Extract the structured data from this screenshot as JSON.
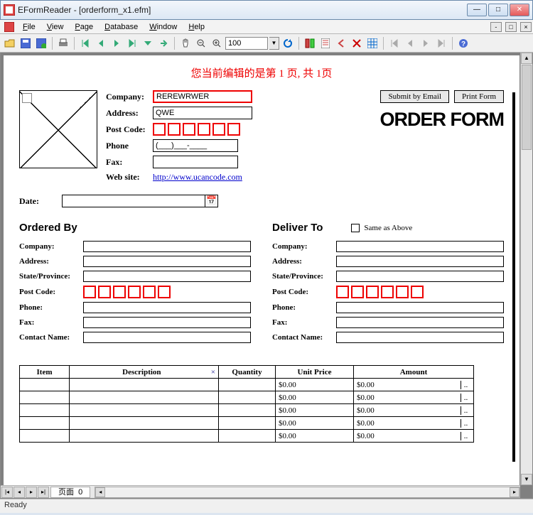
{
  "window": {
    "title": "EFormReader - [orderform_x1.efm]"
  },
  "menu": {
    "file": "File",
    "view": "View",
    "page": "Page",
    "database": "Database",
    "window": "Window",
    "help": "Help"
  },
  "toolbar": {
    "zoom_value": "100"
  },
  "banner": "您当前编辑的是第 1 页, 共 1页",
  "header": {
    "company_label": "Company:",
    "company_value": "REREWRWER",
    "address_label": "Address:",
    "address_value": "QWE",
    "postcode_label": "Post Code:",
    "phone_label": "Phone",
    "phone_value": "(___)___-____",
    "fax_label": "Fax:",
    "website_label": "Web site:",
    "website_value": "http://www.ucancode.com",
    "submit_btn": "Submit by Email",
    "print_btn": "Print Form",
    "title": "ORDER FORM"
  },
  "date": {
    "label": "Date:"
  },
  "ordered_by": {
    "title": "Ordered By",
    "company": "Company:",
    "address": "Address:",
    "state": "State/Province:",
    "postcode": "Post Code:",
    "phone": "Phone:",
    "fax": "Fax:",
    "contact": "Contact Name:"
  },
  "deliver_to": {
    "title": "Deliver To",
    "same": "Same as Above",
    "company": "Company:",
    "address": "Address:",
    "state": "State/Province:",
    "postcode": "Post Code:",
    "phone": "Phone:",
    "fax": "Fax:",
    "contact": "Contact Name:"
  },
  "items": {
    "headers": {
      "item": "Item",
      "desc": "Description",
      "qty": "Quantity",
      "unit": "Unit Price",
      "amount": "Amount"
    },
    "rows": [
      {
        "unit": "$0.00",
        "amount": "$0.00"
      },
      {
        "unit": "$0.00",
        "amount": "$0.00"
      },
      {
        "unit": "$0.00",
        "amount": "$0.00"
      },
      {
        "unit": "$0.00",
        "amount": "$0.00"
      },
      {
        "unit": "$0.00",
        "amount": "$0.00"
      }
    ],
    "ellipsis": ".."
  },
  "hscroll": {
    "tab": "页面",
    "num": "0"
  },
  "status": {
    "text": "Ready"
  }
}
